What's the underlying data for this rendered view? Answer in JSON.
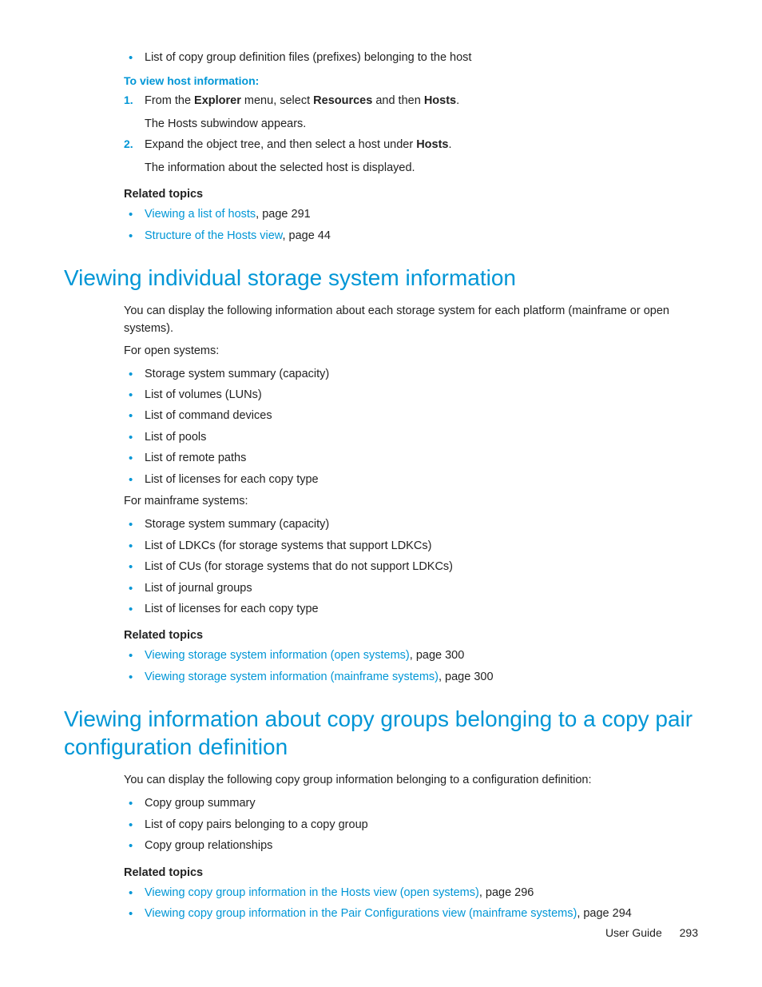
{
  "intro": {
    "bullet1": "List of copy group definition files (prefixes) belonging to the host",
    "subhead": "To view host information:",
    "step1_prefix": "From the ",
    "step1_bold1": "Explorer",
    "step1_mid1": " menu, select ",
    "step1_bold2": "Resources",
    "step1_mid2": " and then ",
    "step1_bold3": "Hosts",
    "step1_suffix": ".",
    "step1_sub": "The Hosts subwindow appears.",
    "step2_prefix": "Expand the object tree, and then select a host under ",
    "step2_bold": "Hosts",
    "step2_suffix": ".",
    "step2_sub": "The information about the selected host is displayed.",
    "related_head": "Related topics",
    "rel1_link": "Viewing a list of hosts",
    "rel1_suffix": ", page 291",
    "rel2_link": "Structure of the Hosts view",
    "rel2_suffix": ", page 44"
  },
  "section1": {
    "heading": "Viewing individual storage system information",
    "p1": "You can display the following information about each storage system for each platform (mainframe or open systems).",
    "p2": "For open systems:",
    "open_items": [
      "Storage system summary (capacity)",
      "List of volumes (LUNs)",
      "List of command devices",
      "List of pools",
      "List of remote paths",
      "List of licenses for each copy type"
    ],
    "p3": "For mainframe systems:",
    "mf_items": [
      "Storage system summary (capacity)",
      "List of LDKCs (for storage systems that support LDKCs)",
      "List of CUs (for storage systems that do not support LDKCs)",
      "List of journal groups",
      "List of licenses for each copy type"
    ],
    "related_head": "Related topics",
    "rel1_link": "Viewing storage system information (open systems)",
    "rel1_suffix": ", page 300",
    "rel2_link": "Viewing storage system information (mainframe systems)",
    "rel2_suffix": ", page 300"
  },
  "section2": {
    "heading": "Viewing information about copy groups belonging to a copy pair configuration definition",
    "p1": "You can display the following copy group information belonging to a configuration definition:",
    "items": [
      "Copy group summary",
      "List of copy pairs belonging to a copy group",
      "Copy group relationships"
    ],
    "related_head": "Related topics",
    "rel1_link": "Viewing copy group information in the Hosts view (open systems)",
    "rel1_suffix": ", page 296",
    "rel2_link": "Viewing copy group information in the Pair Configurations view (mainframe systems)",
    "rel2_suffix": ", page 294"
  },
  "footer": {
    "label": "User Guide",
    "page": "293"
  }
}
